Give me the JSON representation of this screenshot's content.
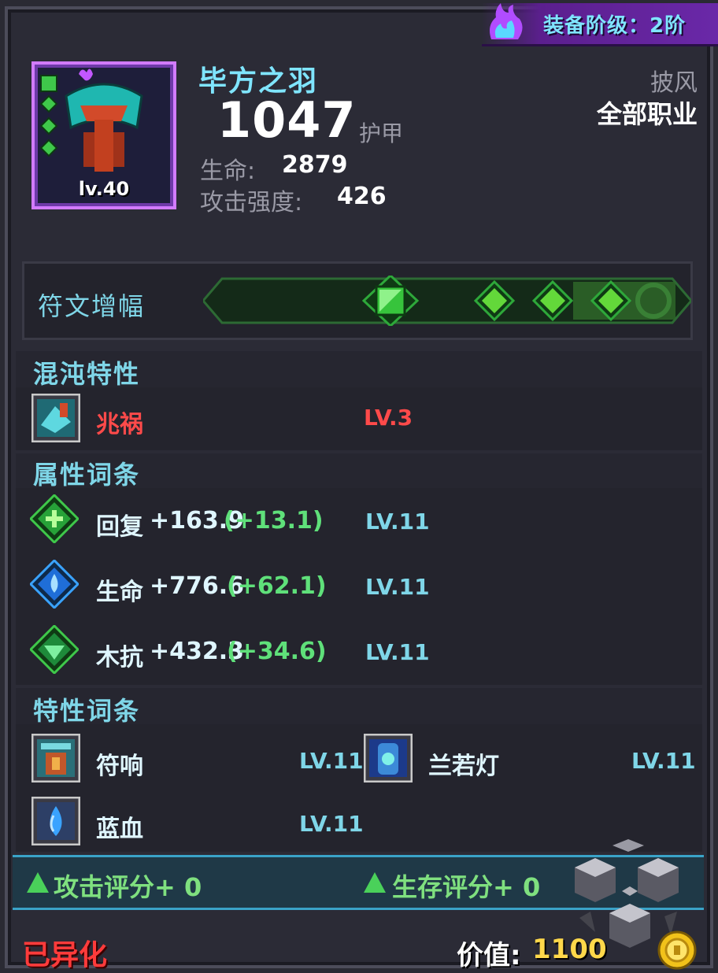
{
  "tier": {
    "label": "装备阶级：2阶"
  },
  "item": {
    "name": "毕方之羽",
    "level": "lv.40",
    "armor_value": "1047",
    "armor_label": "护甲",
    "slot_type": "披风",
    "class_requirement": "全部职业",
    "stats": [
      {
        "label": "生命:",
        "value": "2879"
      },
      {
        "label": "攻击强度:",
        "value": "426"
      }
    ]
  },
  "rune": {
    "label": "符文增幅",
    "filled": 4,
    "total": 5
  },
  "chaos": {
    "title": "混沌特性",
    "entries": [
      {
        "name": "兆祸",
        "level": "LV.3",
        "icon": "chaos-omen-icon"
      }
    ]
  },
  "attributes": {
    "title": "属性词条",
    "entries": [
      {
        "name": "回复",
        "value": "+163.9",
        "bonus": "(+13.1)",
        "level": "LV.11",
        "icon": "regen-gem-icon"
      },
      {
        "name": "生命",
        "value": "+776.6",
        "bonus": "(+62.1)",
        "level": "LV.11",
        "icon": "life-gem-icon"
      },
      {
        "name": "木抗",
        "value": "+432.3",
        "bonus": "(+34.6)",
        "level": "LV.11",
        "icon": "wood-resist-gem-icon"
      }
    ]
  },
  "traits": {
    "title": "特性词条",
    "entries": [
      {
        "name": "符响",
        "level": "LV.11",
        "icon": "rune-echo-icon"
      },
      {
        "name": "兰若灯",
        "level": "LV.11",
        "icon": "lantern-icon"
      },
      {
        "name": "蓝血",
        "level": "LV.11",
        "icon": "blue-blood-icon"
      }
    ]
  },
  "scores": {
    "attack": "攻击评分+ 0",
    "survival": "生存评分+ 0"
  },
  "footer": {
    "mutated": "已异化",
    "value_label": "价值:",
    "value_amount": "1100"
  },
  "colors": {
    "accent_cyan": "#7fd6e8",
    "title_cyan": "#7fe5ff",
    "chaos_red": "#ff4a4a",
    "bonus_green": "#5fe07a",
    "score_green": "#7fe07f",
    "gold": "#ffd84a"
  }
}
